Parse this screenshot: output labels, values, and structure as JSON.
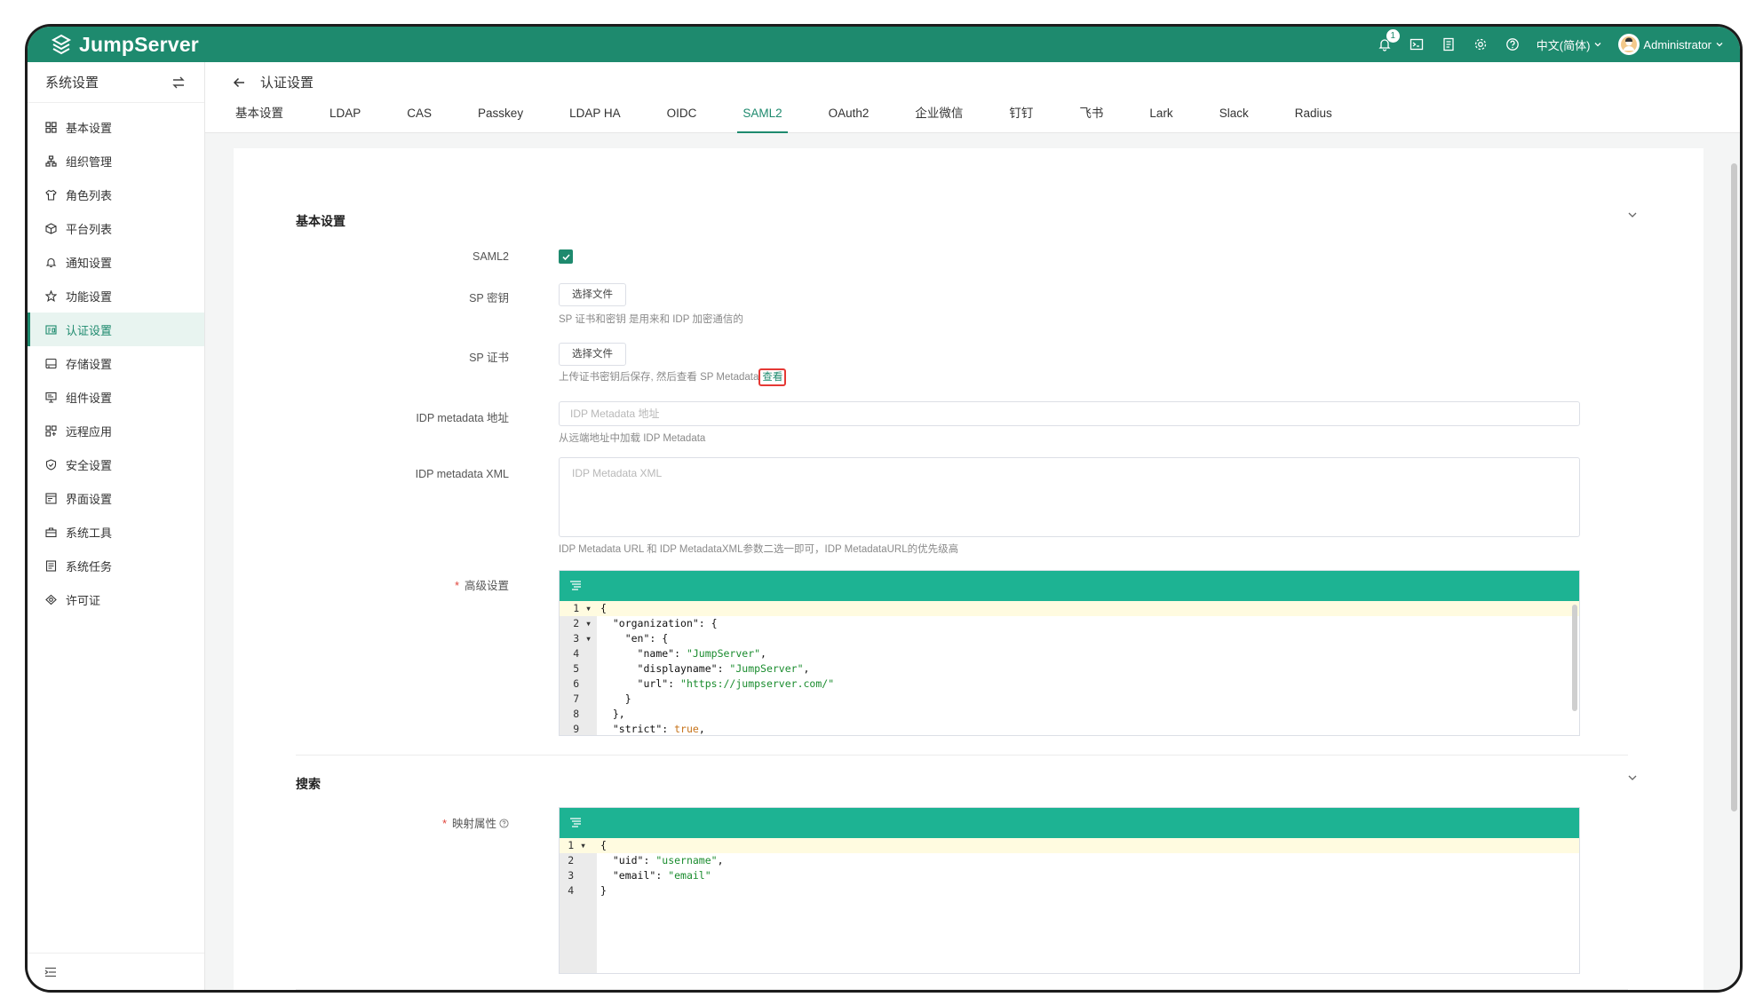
{
  "app": {
    "name": "JumpServer"
  },
  "header": {
    "notification_count": "1",
    "language": "中文(简体)",
    "user": "Administrator"
  },
  "sidebar": {
    "title": "系统设置",
    "items": [
      {
        "label": "基本设置",
        "icon": "grid-icon"
      },
      {
        "label": "组织管理",
        "icon": "org-icon"
      },
      {
        "label": "角色列表",
        "icon": "shirt-icon"
      },
      {
        "label": "平台列表",
        "icon": "cube-icon"
      },
      {
        "label": "通知设置",
        "icon": "bell-icon"
      },
      {
        "label": "功能设置",
        "icon": "star-icon"
      },
      {
        "label": "认证设置",
        "icon": "id-card-icon",
        "active": true
      },
      {
        "label": "存储设置",
        "icon": "storage-icon"
      },
      {
        "label": "组件设置",
        "icon": "monitor-icon"
      },
      {
        "label": "远程应用",
        "icon": "apps-icon"
      },
      {
        "label": "安全设置",
        "icon": "shield-icon"
      },
      {
        "label": "界面设置",
        "icon": "interface-icon"
      },
      {
        "label": "系统工具",
        "icon": "toolbox-icon"
      },
      {
        "label": "系统任务",
        "icon": "task-icon"
      },
      {
        "label": "许可证",
        "icon": "license-icon"
      }
    ]
  },
  "page": {
    "title": "认证设置"
  },
  "tabs": [
    "基本设置",
    "LDAP",
    "CAS",
    "Passkey",
    "LDAP HA",
    "OIDC",
    "SAML2",
    "OAuth2",
    "企业微信",
    "钉钉",
    "飞书",
    "Lark",
    "Slack",
    "Radius"
  ],
  "active_tab": "SAML2",
  "form": {
    "section_basic": "基本设置",
    "saml2_label": "SAML2",
    "saml2_checked": true,
    "sp_key_label": "SP 密钥",
    "sp_key_button": "选择文件",
    "sp_key_hint": "SP 证书和密钥 是用来和 IDP 加密通信的",
    "sp_cert_label": "SP 证书",
    "sp_cert_button": "选择文件",
    "sp_cert_hint": "上传证书密钥后保存, 然后查看 SP Metadata",
    "sp_cert_link": "查看",
    "idp_url_label": "IDP metadata 地址",
    "idp_url_placeholder": "IDP Metadata 地址",
    "idp_url_hint": "从远端地址中加载 IDP Metadata",
    "idp_xml_label": "IDP metadata XML",
    "idp_xml_placeholder": "IDP Metadata XML",
    "idp_xml_hint": "IDP Metadata URL 和 IDP MetadataXML参数二选一即可，IDP MetadataURL的优先级高",
    "advanced_label": "高级设置",
    "section_search": "搜索",
    "mapping_label": "映射属性"
  },
  "advanced_code": [
    {
      "ln": "1",
      "fold": true
    },
    {
      "ln": "2",
      "fold": true
    },
    {
      "ln": "3",
      "fold": true
    },
    {
      "ln": "4"
    },
    {
      "ln": "5"
    },
    {
      "ln": "6"
    },
    {
      "ln": "7"
    },
    {
      "ln": "8"
    },
    {
      "ln": "9"
    }
  ],
  "advanced_json": {
    "org_key": "\"organization\"",
    "en_key": "\"en\"",
    "name_key": "\"name\"",
    "name_val": "\"JumpServer\"",
    "displayname_key": "\"displayname\"",
    "displayname_val": "\"JumpServer\"",
    "url_key": "\"url\"",
    "url_val": "\"https://jumpserver.com/\"",
    "strict_key": "\"strict\"",
    "strict_val": "true"
  },
  "mapping_json": {
    "uid_key": "\"uid\"",
    "uid_val": "\"username\"",
    "email_key": "\"email\"",
    "email_val": "\"email\""
  },
  "colors": {
    "brand": "#1e8a6e",
    "editor_toolbar": "#1db393",
    "highlight": "#e53935"
  }
}
